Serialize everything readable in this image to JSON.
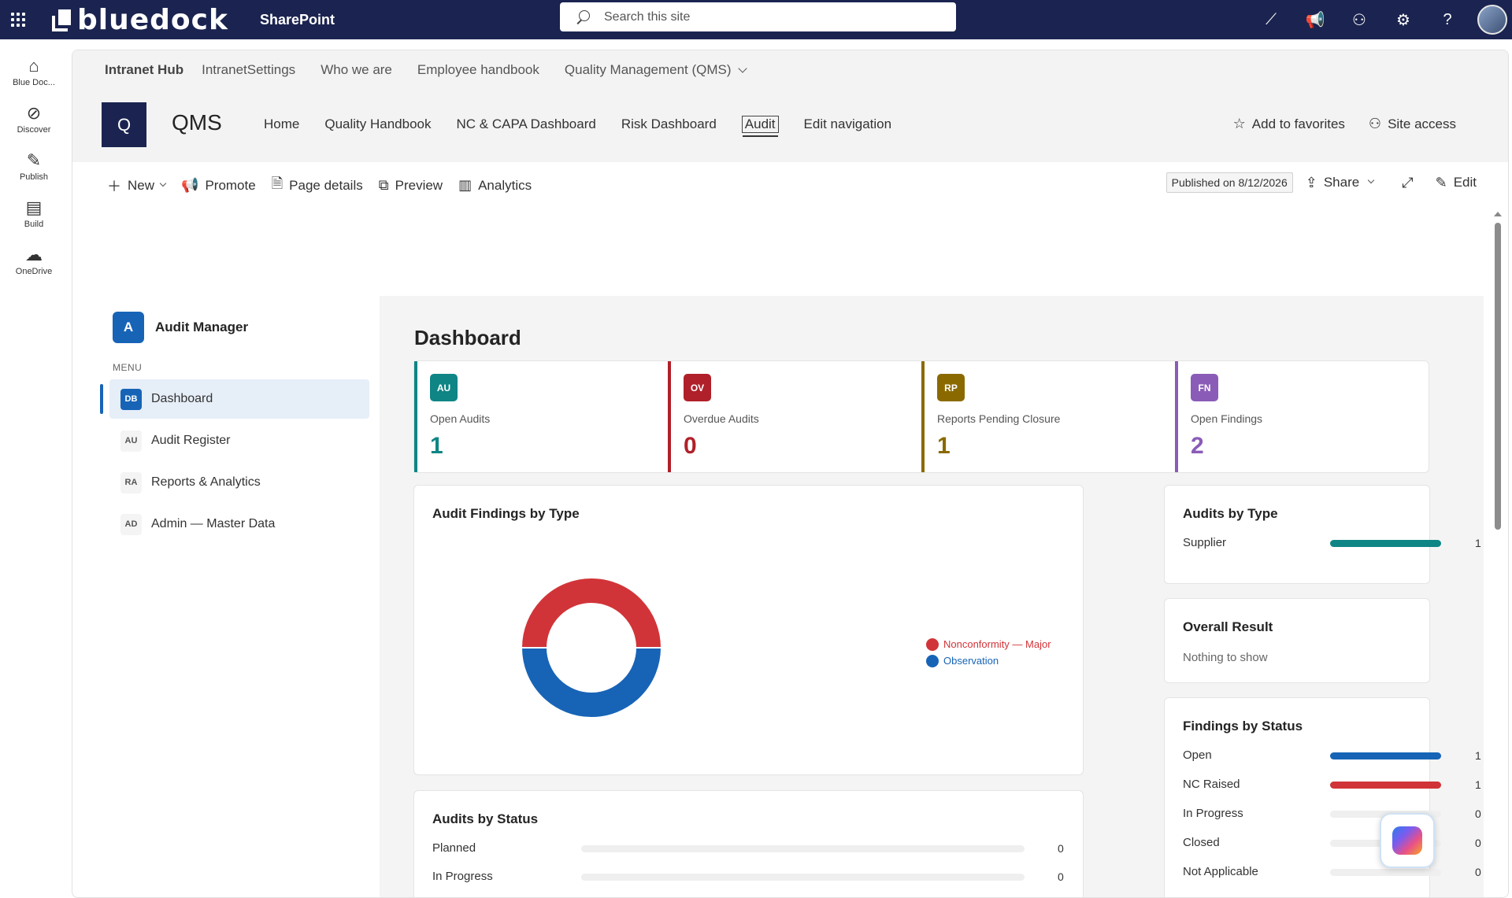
{
  "suite": {
    "brand": "bluedock",
    "app": "SharePoint",
    "search_placeholder": "Search this site",
    "right_icons": [
      "copilot-glyph-icon",
      "megaphone-icon",
      "share-people-icon",
      "settings-gear-icon",
      "help-icon"
    ]
  },
  "appbar": [
    {
      "label": "Blue Doc...",
      "icon": "home-icon"
    },
    {
      "label": "Discover",
      "icon": "compass-icon"
    },
    {
      "label": "Publish",
      "icon": "pen-icon"
    },
    {
      "label": "Build",
      "icon": "layout-icon"
    },
    {
      "label": "OneDrive",
      "icon": "cloud-icon"
    }
  ],
  "hubnav": {
    "title": "Intranet Hub",
    "links": [
      "IntranetSettings",
      "Who we are",
      "Employee handbook",
      "Quality Management (QMS)"
    ]
  },
  "site": {
    "logo_letter": "Q",
    "title": "QMS",
    "nav": [
      "Home",
      "Quality Handbook",
      "NC & CAPA Dashboard",
      "Risk Dashboard",
      "Audit",
      "Edit navigation"
    ],
    "current_nav": "Audit",
    "add_favorites": "Add to favorites",
    "site_access": "Site access"
  },
  "commands": {
    "new": "New",
    "promote": "Promote",
    "page_details": "Page details",
    "preview": "Preview",
    "analytics": "Analytics",
    "published": "Published on 8/12/2026",
    "share": "Share",
    "edit": "Edit"
  },
  "audit_app": {
    "logo_letter": "A",
    "title": "Audit Manager",
    "menu_caption": "MENU",
    "menu": [
      {
        "chip": "DB",
        "label": "Dashboard",
        "active": true
      },
      {
        "chip": "AU",
        "label": "Audit Register",
        "active": false
      },
      {
        "chip": "RA",
        "label": "Reports & Analytics",
        "active": false
      },
      {
        "chip": "AD",
        "label": "Admin — Master Data",
        "active": false
      }
    ]
  },
  "dashboard": {
    "title": "Dashboard",
    "kpis": [
      {
        "chip": "AU",
        "label": "Open Audits",
        "value": "1",
        "color": "#0f8585"
      },
      {
        "chip": "OV",
        "label": "Overdue Audits",
        "value": "0",
        "color": "#b0202a"
      },
      {
        "chip": "RP",
        "label": "Reports Pending Closure",
        "value": "1",
        "color": "#8a6a00"
      },
      {
        "chip": "FN",
        "label": "Open Findings",
        "value": "2",
        "color": "#8a5cb8"
      }
    ],
    "findings_by_type": {
      "title": "Audit Findings by Type"
    },
    "audits_by_type": {
      "title": "Audits by Type"
    },
    "overall_result": {
      "title": "Overall Result",
      "empty": "Nothing to show"
    },
    "findings_by_status": {
      "title": "Findings by Status"
    },
    "audits_by_status": {
      "title": "Audits by Status"
    }
  },
  "chart_data": [
    {
      "type": "pie",
      "title": "Audit Findings by Type",
      "categories": [
        "Nonconformity — Major",
        "Observation"
      ],
      "values": [
        1,
        1
      ],
      "colors": [
        "#d13438",
        "#1764b7"
      ],
      "donut": true,
      "legend": "right"
    },
    {
      "type": "bar",
      "title": "Audits by Type",
      "categories": [
        "Supplier"
      ],
      "values": [
        1
      ],
      "colors": [
        "#0f8585"
      ],
      "max": 1
    },
    {
      "type": "bar",
      "title": "Findings by Status",
      "categories": [
        "Open",
        "NC Raised",
        "In Progress",
        "Closed",
        "Not Applicable"
      ],
      "values": [
        1,
        1,
        0,
        0,
        0
      ],
      "colors": [
        "#1764b7",
        "#d13438",
        "#e0e0e0",
        "#e0e0e0",
        "#e0e0e0"
      ],
      "max": 1
    },
    {
      "type": "bar",
      "title": "Audits by Status",
      "categories": [
        "Planned",
        "In Progress"
      ],
      "values": [
        0,
        0
      ],
      "colors": [
        "#1764b7",
        "#1764b7"
      ],
      "max": 1
    }
  ]
}
